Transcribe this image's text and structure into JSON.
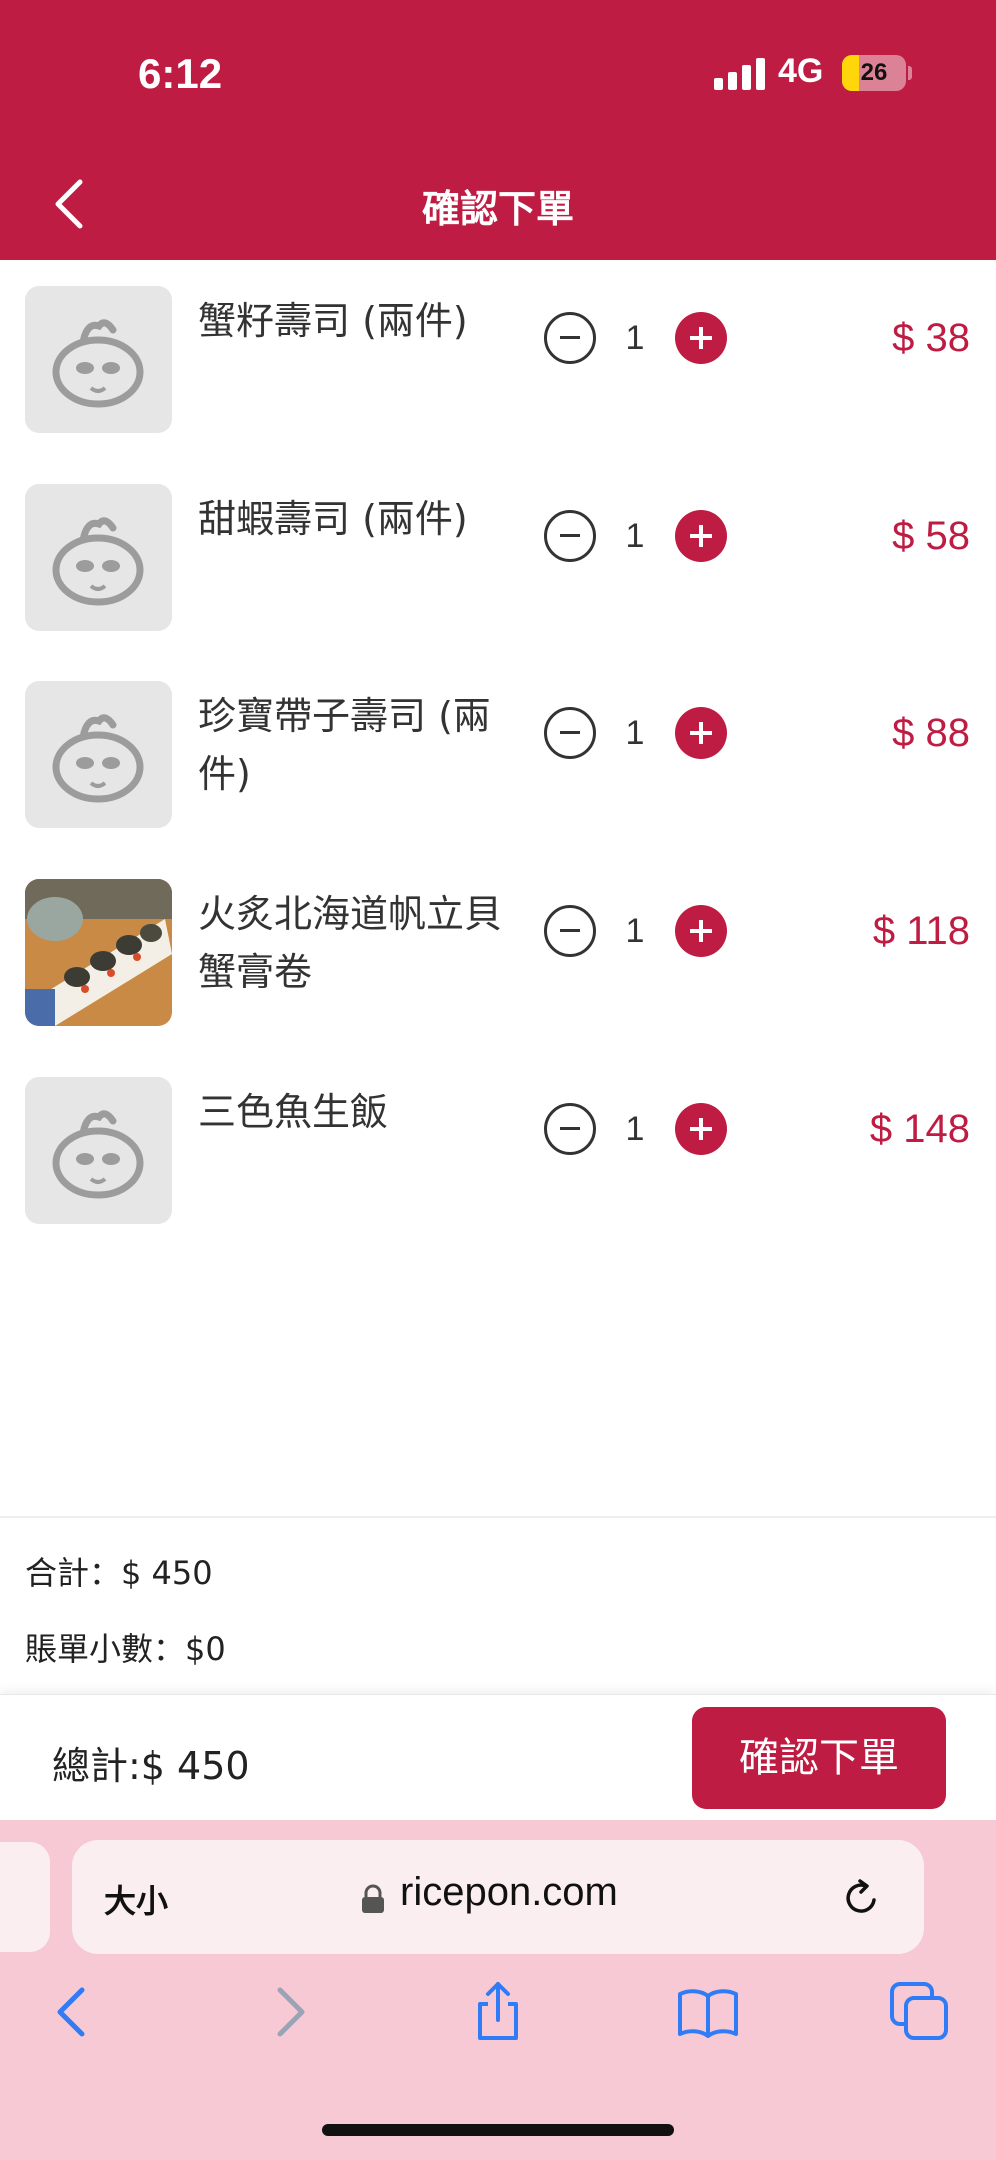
{
  "status_bar": {
    "time": "6:12",
    "network": "4G",
    "battery": "26",
    "battery_level": 0.26
  },
  "header": {
    "title": "確認下單",
    "back_icon": "chevron-left-icon"
  },
  "items": [
    {
      "name": "蟹籽壽司 (兩件)",
      "qty": "1",
      "price": "$ 38",
      "thumb": "mascot-placeholder"
    },
    {
      "name": "甜蝦壽司 (兩件)",
      "qty": "1",
      "price": "$ 58",
      "thumb": "mascot-placeholder"
    },
    {
      "name": "珍寶帶子壽司 (兩件)",
      "qty": "1",
      "price": "$ 88",
      "thumb": "mascot-placeholder"
    },
    {
      "name": "火炙北海道帆立貝蟹膏卷",
      "qty": "1",
      "price": "$ 118",
      "thumb": "sushi-photo"
    },
    {
      "name": "三色魚生飯",
      "qty": "1",
      "price": "$ 148",
      "thumb": "mascot-placeholder"
    }
  ],
  "summary": {
    "subtotal": "合計：$ 450",
    "rounding": "賬單小數：$0"
  },
  "footer": {
    "total": "總計:$ 450",
    "confirm": "確認下單"
  },
  "browser": {
    "text_size": "大小",
    "domain": "ricepon.com"
  },
  "colors": {
    "brand": "#be1c42",
    "browser_bg": "#f6c9d4",
    "ios_blue": "#2f7cf6"
  }
}
